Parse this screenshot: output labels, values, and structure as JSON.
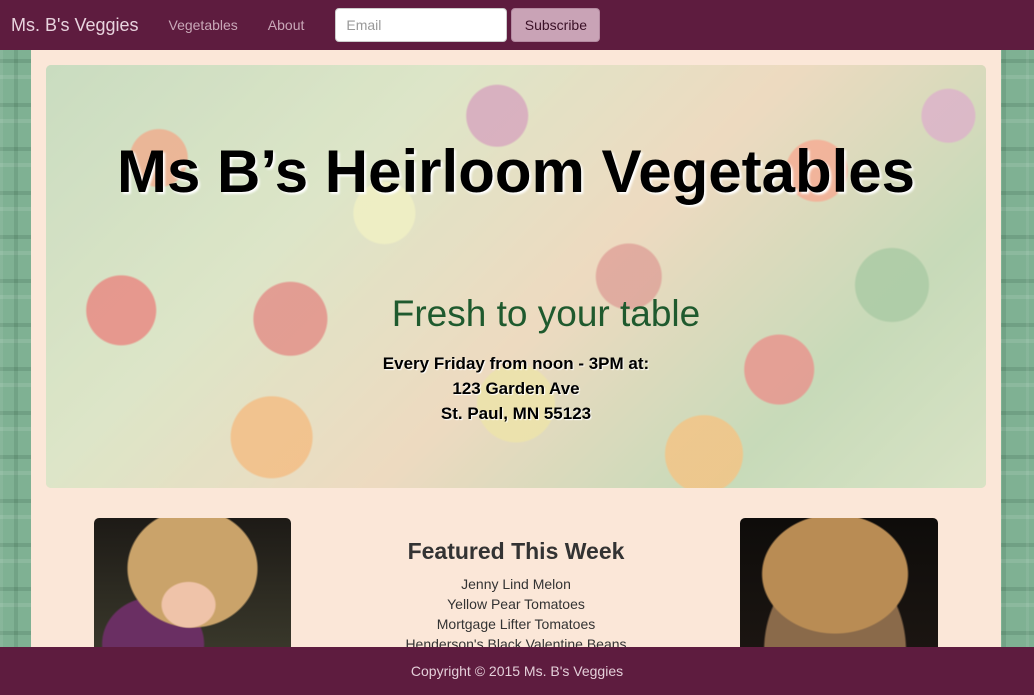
{
  "navbar": {
    "brand": "Ms. B's Veggies",
    "links": [
      "Vegetables",
      "About"
    ],
    "email_placeholder": "Email",
    "subscribe_label": "Subscribe"
  },
  "hero": {
    "title": "Ms B’s Heirloom Vegetables",
    "tagline": "Fresh to your table",
    "info_lines": [
      "Every Friday from noon - 3PM at:",
      "123 Garden Ave",
      "St. Paul, MN 55123"
    ]
  },
  "featured": {
    "title": "Featured This Week",
    "items": [
      "Jenny Lind Melon",
      "Yellow Pear Tomatoes",
      "Mortgage Lifter Tomatoes",
      "Henderson's Black Valentine Beans"
    ]
  },
  "footer": {
    "copyright": "Copyright © 2015 Ms. B's Veggies"
  },
  "colors": {
    "nav_background": "#5e1c3f",
    "container_background": "#fbe7d8",
    "tagline": "#1f5a2e",
    "subscribe_button": "#c9a3b6"
  }
}
